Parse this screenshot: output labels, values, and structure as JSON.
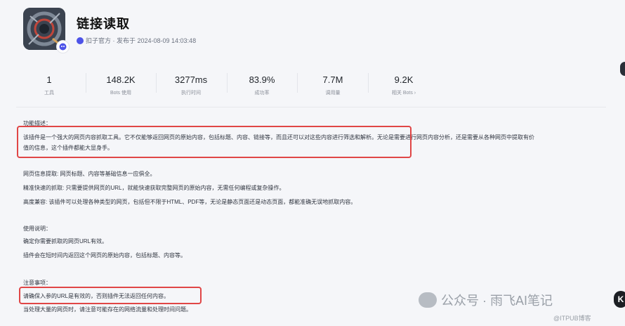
{
  "header": {
    "title": "链接读取",
    "meta": "扣子官方 · 发布于 2024-08-09 14:03:48"
  },
  "stats": [
    {
      "value": "1",
      "label": "工具"
    },
    {
      "value": "148.2K",
      "label": "Bots 使用"
    },
    {
      "value": "3277ms",
      "label": "执行时间"
    },
    {
      "value": "83.9%",
      "label": "成功率"
    },
    {
      "value": "7.7M",
      "label": "调用量"
    },
    {
      "value": "9.2K",
      "label": "相关 Bots ›"
    }
  ],
  "content": {
    "h_func": "功能描述：",
    "p1_line1": "该插件是一个强大的网页内容抓取工具。它不仅能够返回网页的原始内容，包括标题、内容、链接等，而且还可以对这些内容进行筛选和解析。无论是需要进行网页内容分析，还是需要从各种网页中提取有价",
    "p1_line2": "值的信息，这个插件都能大显身手。",
    "f1": "网页信息提取: 网页标题、内容等基础信息一应俱全。",
    "f2": "精准快速的抓取: 只需要提供网页的URL，就能快速获取完整网页的原始内容，无需任何编程或复杂操作。",
    "f3": "高度兼容: 该插件可以处理各种类型的网页，包括但不限于HTML、PDF等，无论是静态页面还是动态页面，都能准确无误地抓取内容。",
    "h_usage": "使用说明：",
    "u1": "确定你需要抓取的网页URL有效。",
    "u2": "插件会在短时间内返回这个网页的原始内容，包括标题、内容等。",
    "h_note": "注意事项：",
    "n1": "请确保入参的URL是有效的，否则插件无法返回任何内容。",
    "n2": "当处理大量的网页时，请注意可能存在的网络流量和处理时间问题。"
  },
  "watermark": {
    "text": "公众号 · 雨飞AI笔记",
    "site": "@ITPUB博客"
  }
}
